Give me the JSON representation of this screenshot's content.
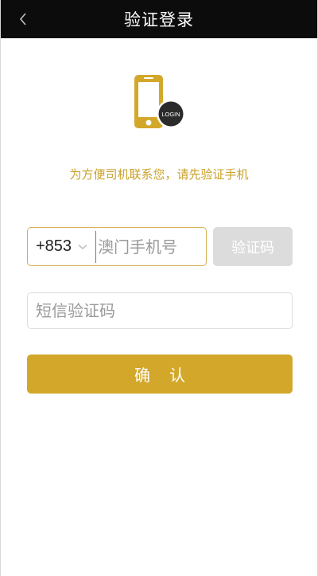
{
  "header": {
    "title": "验证登录",
    "back_icon": "chevron-left-icon"
  },
  "hero": {
    "icon": "phone-login-icon",
    "badge_text": "LOGIN"
  },
  "tagline": "为方便司机联系您，请先验证手机",
  "phone": {
    "country_code": "+853",
    "dropdown_icon": "chevron-down-icon",
    "placeholder": "澳门手机号",
    "value": ""
  },
  "get_code_label": "验证码",
  "sms": {
    "placeholder": "短信验证码",
    "value": ""
  },
  "confirm_label": "确认",
  "colors": {
    "header_bg": "#0c0c0c",
    "accent": "#d3a72a",
    "tagline": "#caa12b",
    "disabled_btn": "#dcdcdc"
  }
}
